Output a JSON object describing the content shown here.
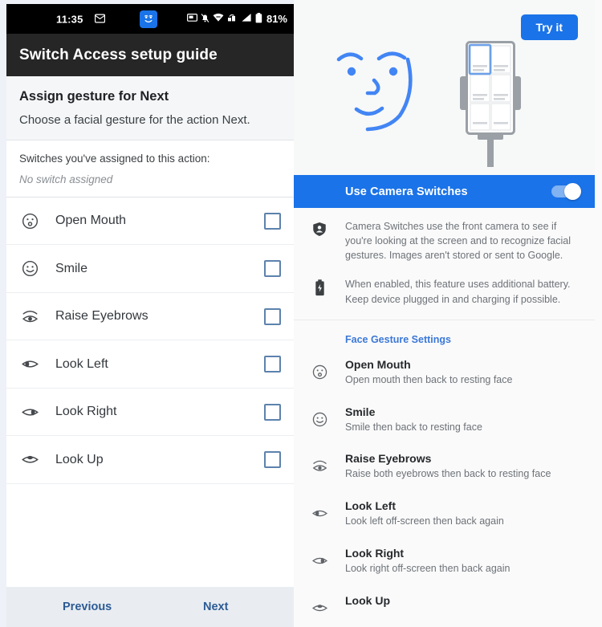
{
  "left": {
    "statusbar": {
      "time": "11:35",
      "battery_percent": "81%",
      "icons": [
        "mail-icon",
        "camera-switches-face-icon",
        "screenshot-icon",
        "notifications-off-icon",
        "wifi-icon",
        "vpn-icon",
        "signal-icon",
        "battery-icon"
      ]
    },
    "titlebar": {
      "title": "Switch Access setup guide"
    },
    "header": {
      "title": "Assign gesture for Next",
      "subtitle": "Choose a facial gesture for the action Next."
    },
    "assigned": {
      "label": "Switches you've assigned to this action:",
      "value": "No switch assigned"
    },
    "gestures": [
      {
        "label": "Open Mouth",
        "icon": "face-open-mouth-icon",
        "checked": false
      },
      {
        "label": "Smile",
        "icon": "face-smile-icon",
        "checked": false
      },
      {
        "label": "Raise Eyebrows",
        "icon": "eye-eyebrow-icon",
        "checked": false
      },
      {
        "label": "Look Left",
        "icon": "eye-left-icon",
        "checked": false
      },
      {
        "label": "Look Right",
        "icon": "eye-right-icon",
        "checked": false
      },
      {
        "label": "Look Up",
        "icon": "eye-up-icon",
        "checked": false
      }
    ],
    "bottom_nav": {
      "previous": "Previous",
      "next": "Next"
    }
  },
  "right": {
    "hero": {
      "try_it_label": "Try it",
      "illustration": [
        "line-art-face-illustration",
        "phone-on-stand-illustration"
      ]
    },
    "toggle": {
      "label": "Use Camera Switches",
      "enabled": true
    },
    "info": [
      {
        "icon": "privacy-shield-icon",
        "text": "Camera Switches use the front camera to see if you're looking at the screen and to recognize facial gestures. Images aren't stored or sent to Google."
      },
      {
        "icon": "battery-charging-icon",
        "text": "When enabled, this feature uses additional battery. Keep device plugged in and charging if possible."
      }
    ],
    "section_title": "Face Gesture Settings",
    "gestures": [
      {
        "title": "Open Mouth",
        "desc": "Open mouth then back to resting face",
        "icon": "face-open-mouth-icon"
      },
      {
        "title": "Smile",
        "desc": "Smile then back to resting face",
        "icon": "face-smile-icon"
      },
      {
        "title": "Raise Eyebrows",
        "desc": "Raise both eyebrows then back to resting face",
        "icon": "eye-eyebrow-icon"
      },
      {
        "title": "Look Left",
        "desc": "Look left off-screen then back again",
        "icon": "eye-left-icon"
      },
      {
        "title": "Look Right",
        "desc": "Look right off-screen then back again",
        "icon": "eye-right-icon"
      },
      {
        "title": "Look Up",
        "desc": "",
        "icon": "eye-up-icon"
      }
    ]
  },
  "colors": {
    "accent_blue": "#1a73e8",
    "status_black": "#000000",
    "titlebar_dark": "#262626",
    "checkbox_blue": "#5c82ad",
    "nav_link_blue": "#2d5b94",
    "section_link_blue": "#3b78d8",
    "illustration_blue": "#4285f4"
  }
}
